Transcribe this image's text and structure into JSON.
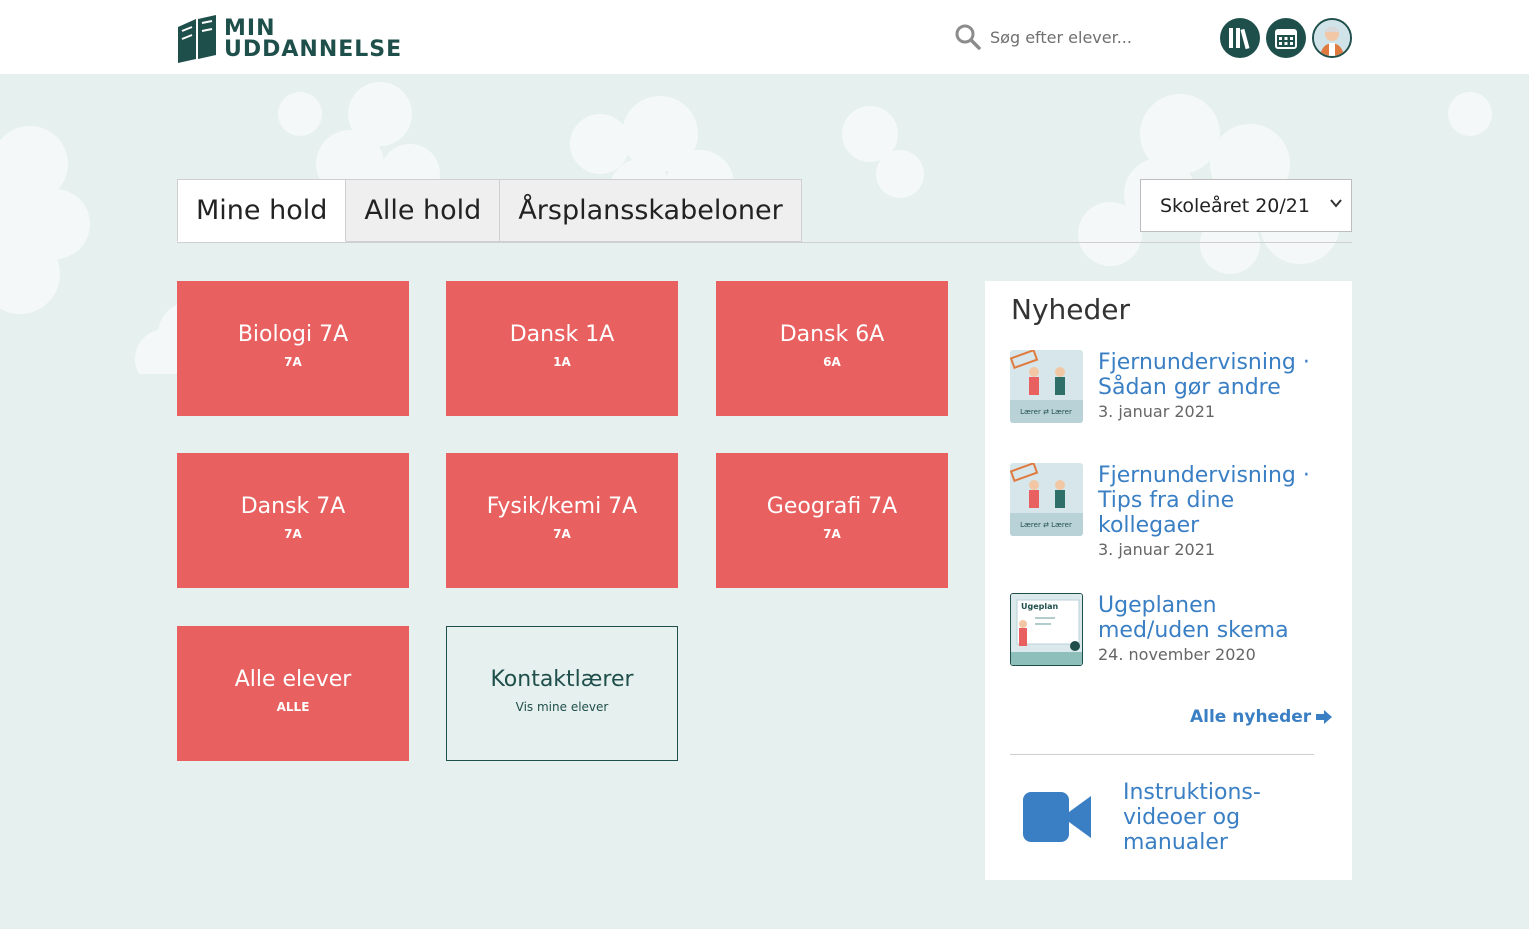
{
  "header": {
    "logo_line1": "MIN",
    "logo_line2": "UDDANNELSE",
    "search_placeholder": "Søg efter elever...",
    "icons": [
      "library-icon",
      "calendar-icon",
      "user-avatar"
    ]
  },
  "tabs": [
    {
      "label": "Mine hold",
      "active": true
    },
    {
      "label": "Alle hold",
      "active": false
    },
    {
      "label": "Årsplansskabeloner",
      "active": false
    }
  ],
  "year_select": {
    "selected": "Skoleåret 20/21"
  },
  "tiles": [
    {
      "title": "Biologi 7A",
      "sub": "7A"
    },
    {
      "title": "Dansk 1A",
      "sub": "1A"
    },
    {
      "title": "Dansk 6A",
      "sub": "6A"
    },
    {
      "title": "Dansk 7A",
      "sub": "7A"
    },
    {
      "title": "Fysik/kemi 7A",
      "sub": "7A"
    },
    {
      "title": "Geografi 7A",
      "sub": "7A"
    },
    {
      "title": "Alle elever",
      "sub": "ALLE"
    },
    {
      "title": "Kontaktlærer",
      "sub": "Vis mine elever"
    }
  ],
  "news": {
    "title": "Nyheder",
    "items": [
      {
        "title": "Fjernundervisning · Sådan gør andre",
        "date": "3. januar 2021",
        "thumb_label": "Lærer ⇄ Lærer"
      },
      {
        "title": "Fjernundervisning · Tips fra dine kollegaer",
        "date": "3. januar 2021",
        "thumb_label": "Lærer ⇄ Lærer"
      },
      {
        "title": "Ugeplanen med/uden skema",
        "date": "24. november 2020",
        "thumb_label": "Ugeplan"
      }
    ],
    "all_news_label": "Alle nyheder",
    "video_label": "Instruktions-videoer og manualer"
  },
  "colors": {
    "brand_dark": "#1f4f4b",
    "tile_red": "#e8605f",
    "link_blue": "#3a7fc4",
    "background": "#e6f0ef"
  }
}
